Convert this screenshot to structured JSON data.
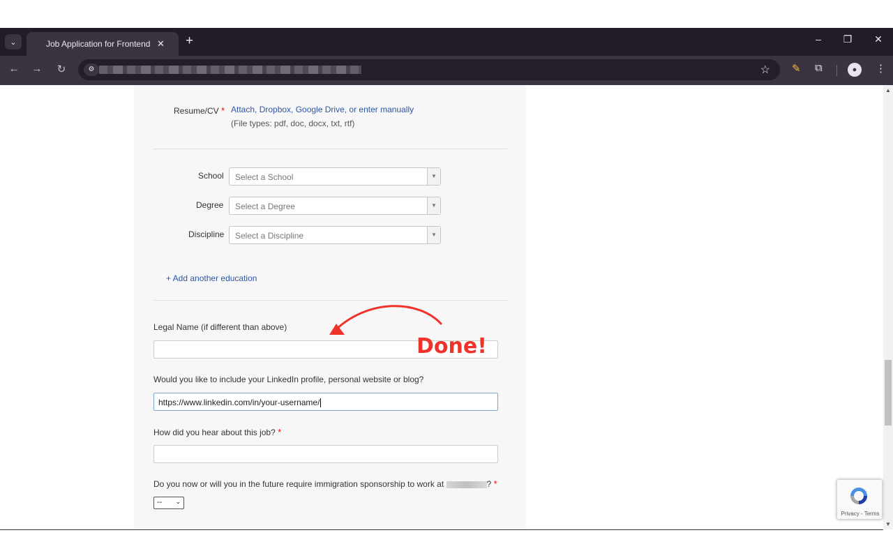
{
  "browser": {
    "tab_title": "Job Application for Frontend So",
    "tab_close": "✕",
    "new_tab": "+",
    "tab_search_icon": "chevron-down-icon",
    "window": {
      "minimize": "–",
      "restore": "❐",
      "close": "✕"
    }
  },
  "form": {
    "resume_label": "Resume/CV",
    "resume_required": "*",
    "resume_link": "Attach, Dropbox, Google Drive, or enter manually",
    "resume_hint": "(File types: pdf, doc, docx, txt, rtf)",
    "school_label": "School",
    "school_placeholder": "Select a School",
    "degree_label": "Degree",
    "degree_placeholder": "Select a Degree",
    "discipline_label": "Discipline",
    "discipline_placeholder": "Select a Discipline",
    "add_education": "+ Add another education",
    "legal_name_label": "Legal Name (if different than above)",
    "legal_name_value": "",
    "linkedin_label": "Would you like to include your LinkedIn profile, personal website or blog?",
    "linkedin_value": "https://www.linkedin.com/in/your-username/",
    "hear_label": "How did you hear about this job?",
    "hear_required": "*",
    "hear_value": "",
    "sponsorship_label_start": "Do you now or will you in the future require immigration sponsorship to work at",
    "sponsorship_label_end": "?",
    "sponsorship_required": "*",
    "sponsorship_selected": "--"
  },
  "annotation": {
    "done_text": "Done!",
    "color": "#f0332a"
  },
  "recaptcha": {
    "terms": "Privacy - Terms"
  }
}
